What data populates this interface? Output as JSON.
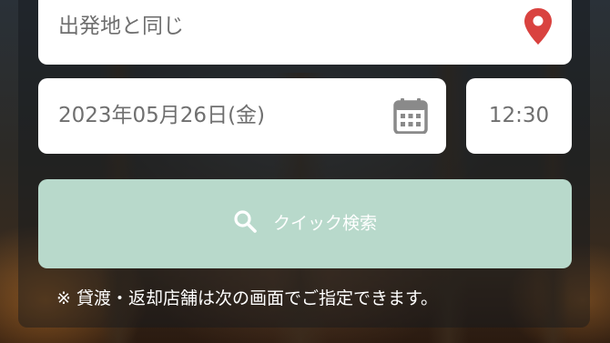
{
  "origin": {
    "value": "出発地と同じ",
    "icon": "map-pin-icon"
  },
  "date": {
    "value": "2023年05月26日(金)",
    "icon": "calendar-icon"
  },
  "time": {
    "value": "12:30"
  },
  "search_button": {
    "label": "クイック検索",
    "icon": "search-icon",
    "background": "#b8d9cb"
  },
  "note": "※ 貸渡・返却店舗は次の画面でご指定できます。",
  "colors": {
    "pin": "#d9423f",
    "calendar": "#8a8a8a",
    "field_text": "#6f6f6f"
  }
}
